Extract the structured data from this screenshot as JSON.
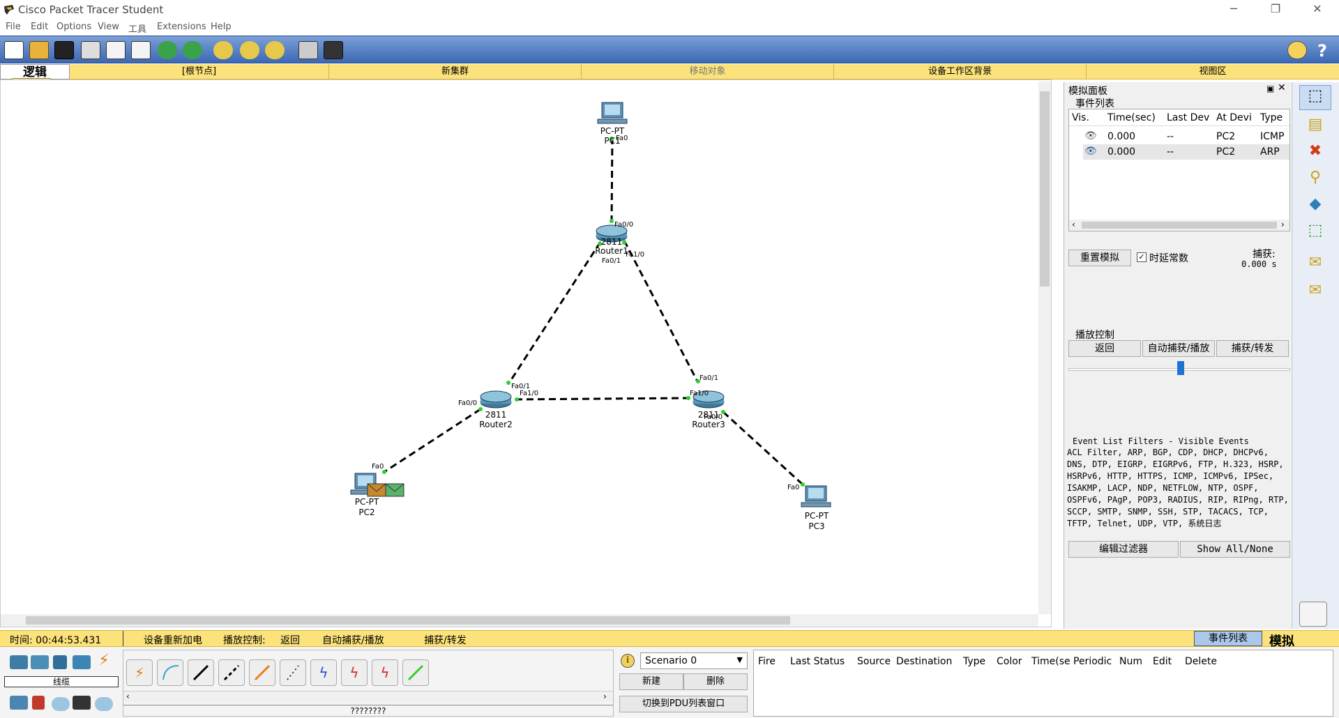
{
  "window": {
    "title": "Cisco Packet Tracer Student",
    "controls": [
      "─",
      "❐",
      "✕"
    ]
  },
  "menu": [
    "File",
    "Edit",
    "Options",
    "View",
    "工具",
    "Extensions",
    "Help"
  ],
  "toolbar_icons": [
    "new-file-icon",
    "open-folder-icon",
    "save-icon",
    "print-icon",
    "activity-wizard-icon",
    "copy-icon",
    "undo-icon",
    "redo-icon",
    "zoom-in-icon",
    "zoom-reset-icon",
    "zoom-out-icon",
    "palette-icon",
    "custom-device-icon"
  ],
  "logical_bar": {
    "mode_label": "逻辑",
    "root": "[根节点]",
    "new_cluster": "新集群",
    "move_object": "移动对象",
    "background": "设备工作区背景",
    "viewport": "视图区"
  },
  "topology": {
    "devices": [
      {
        "id": "pc1",
        "model": "PC-PT",
        "name": "PC1"
      },
      {
        "id": "router1",
        "model": "2811",
        "name": "Router1"
      },
      {
        "id": "router2",
        "model": "2811",
        "name": "Router2"
      },
      {
        "id": "router3",
        "model": "2811",
        "name": "Router3"
      },
      {
        "id": "pc2",
        "model": "PC-PT",
        "name": "PC2"
      },
      {
        "id": "pc3",
        "model": "PC-PT",
        "name": "PC3"
      }
    ],
    "ports": {
      "pc1_fa0": "Fa0",
      "r1_fa00": "Fa0/0",
      "r1_fa01": "Fa0/1",
      "r1_fa10": "Fa1/0",
      "r2_fa01": "Fa0/1",
      "r2_fa10": "Fa1/0",
      "r2_fa00": "Fa0/0",
      "r3_fa01": "Fa0/1",
      "r3_fa10": "Fa1/0",
      "r3_fa00": "Fa0/0",
      "pc2_fa0": "Fa0",
      "pc3_fa0": "Fa0"
    }
  },
  "sim_panel": {
    "title": "模拟面板",
    "event_list_label": "事件列表",
    "columns": [
      "Vis.",
      "Time(sec)",
      "Last Dev",
      "At Devi",
      "Type"
    ],
    "events": [
      {
        "time": "0.000",
        "last": "--",
        "at": "PC2",
        "type": "ICMP"
      },
      {
        "time": "0.000",
        "last": "--",
        "at": "PC2",
        "type": "ARP"
      }
    ],
    "reset_button": "重置模拟",
    "constant_delay_label": "时延常数",
    "capture_label": "捕获:",
    "capture_value": "0.000 s",
    "playback_label": "播放控制",
    "back_button": "返回",
    "auto_capture_button": "自动捕获/播放",
    "capture_forward_button": "捕获/转发",
    "filters_title": "Event List Filters - Visible Events",
    "filters_text": "ACL Filter, ARP, BGP, CDP, DHCP, DHCPv6, DNS, DTP, EIGRP, EIGRPv6, FTP, H.323, HSRP, HSRPv6, HTTP, HTTPS, ICMP, ICMPv6, IPSec, ISAKMP, LACP, NDP, NETFLOW, NTP, OSPF, OSPFv6, PAgP, POP3, RADIUS, RIP, RIPng, RTP, SCCP, SMTP, SNMP, SSH, STP, TACACS, TCP, TFTP, Telnet, UDP, VTP, 系统日志",
    "edit_filters_button": "编辑过滤器",
    "show_all_button": "Show All/None"
  },
  "status_bar": {
    "time": "时间: 00:44:53.431",
    "power_cycle": "设备重新加电",
    "playback_control": "播放控制:",
    "back": "返回",
    "auto": "自动捕获/播放",
    "capture_forward": "捕获/转发",
    "event_list_tab": "事件列表",
    "mode": "模拟"
  },
  "bottom": {
    "category_label": "线缆",
    "cable_name": "????????",
    "scenario_select": "Scenario 0",
    "new_button": "新建",
    "delete_button": "删除",
    "toggle_pdu_button": "切换到PDU列表窗口",
    "pdu_columns": [
      "Fire",
      "Last Status",
      "Source",
      "Destination",
      "Type",
      "Color",
      "Time(se",
      "Periodic",
      "Num",
      "Edit",
      "Delete"
    ]
  }
}
